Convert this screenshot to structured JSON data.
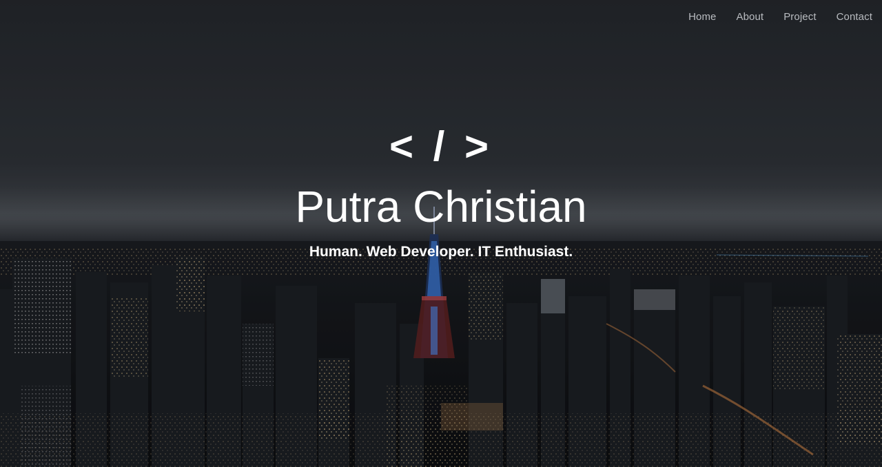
{
  "nav": {
    "items": [
      {
        "label": "Home"
      },
      {
        "label": "About"
      },
      {
        "label": "Project"
      },
      {
        "label": "Contact"
      }
    ]
  },
  "hero": {
    "icon_text": "< / >",
    "title": "Putra Christian",
    "tagline": "Human. Web Developer. IT Enthusiast.",
    "background_image": "night-city-skyline"
  },
  "colors": {
    "sky": "#2b2e33",
    "text": "#ffffff",
    "nav_text": "#b9bcc0",
    "city_lights": "#f3c98a",
    "tower": "#3d7bd6"
  }
}
